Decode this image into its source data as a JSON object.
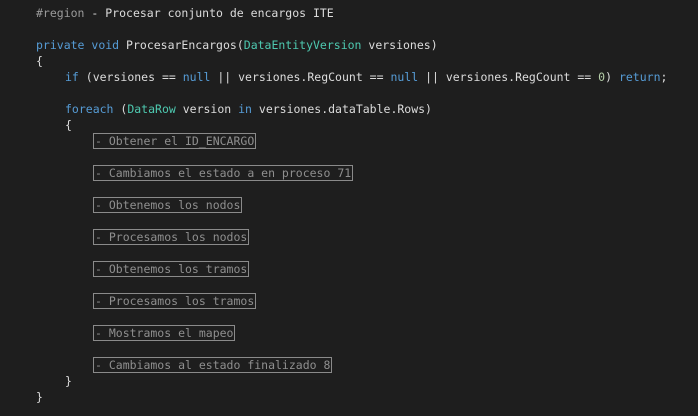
{
  "region": {
    "directive": "#region",
    "title": "- Procesar conjunto de encargos ITE"
  },
  "method": {
    "access": "private",
    "return_type": "void",
    "name": "ProcesarEncargos",
    "open_paren": "(",
    "param_type": "DataEntityVersion",
    "param_name": " versiones",
    "close_paren": ")",
    "open_brace": "{",
    "close_brace": "}"
  },
  "if_stmt": {
    "keyword": "if",
    "cond_open": " (versiones == ",
    "null1": "null",
    "cond_mid1": " || versiones.RegCount == ",
    "null2": "null",
    "cond_mid2": " || versiones.RegCount == ",
    "zero": "0",
    "cond_close": ") ",
    "return_kw": "return",
    "semicolon": ";"
  },
  "foreach_stmt": {
    "keyword": "foreach",
    "open_paren": " (",
    "type": "DataRow",
    "var_name": " version ",
    "in_kw": "in",
    "collection": " versiones.dataTable.Rows)",
    "open_brace": "{",
    "close_brace": "}"
  },
  "collapsed_regions": [
    "- Obtener el ID_ENCARGO",
    "- Cambiamos el estado a en proceso 71",
    "- Obtenemos los nodos",
    "- Procesamos los nodos",
    "- Obtenemos los tramos",
    "- Procesamos los tramos",
    "- Mostramos el mapeo",
    "- Cambiamos al estado finalizado 8"
  ]
}
